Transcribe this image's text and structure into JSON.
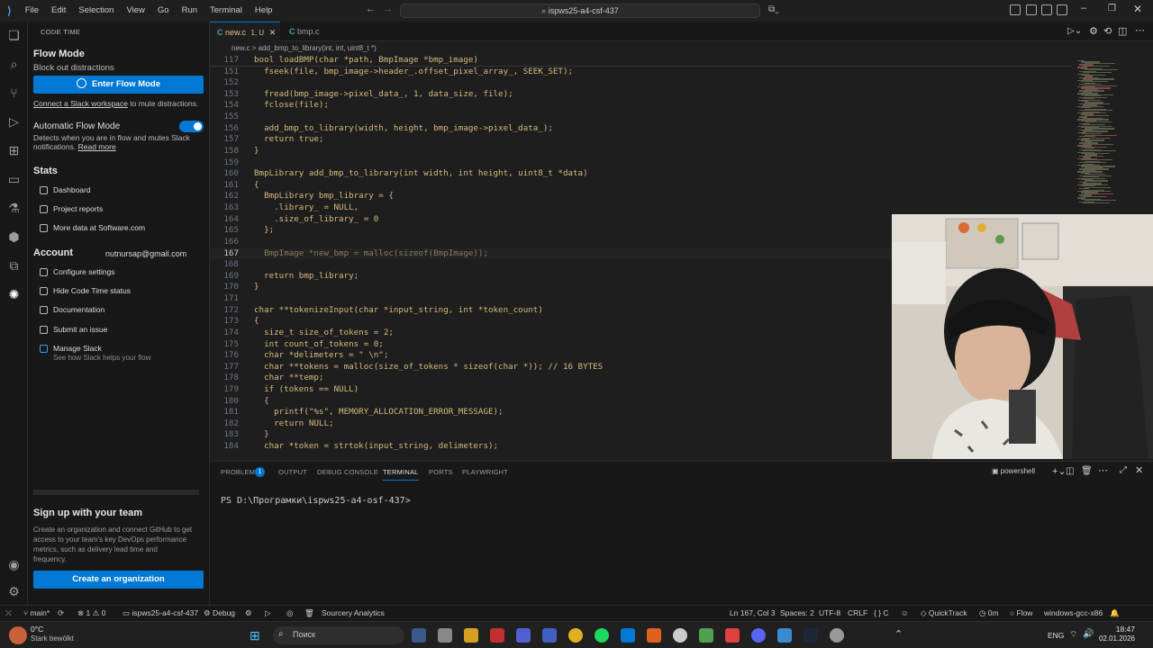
{
  "titlebar": {
    "menu": [
      "File",
      "Edit",
      "Selection",
      "View",
      "Go",
      "Run",
      "Terminal",
      "Help"
    ],
    "search": "ispws25-a4-csf-437"
  },
  "sidebar": {
    "header": "CODE TIME",
    "flow_title": "Flow Mode",
    "flow_sub": "Block out distractions",
    "enter_flow": "Enter Flow Mode",
    "slack_link": "Connect a Slack workspace",
    "slack_rest": " to mute distractions.",
    "auto_title": "Automatic Flow Mode",
    "auto_desc1": "Detects when you are in flow and mutes Slack",
    "auto_desc2": "notifications. ",
    "read_more": "Read more",
    "stats_title": "Stats",
    "stats": [
      "Dashboard",
      "Project reports",
      "More data at Software.com"
    ],
    "account_title": "Account",
    "email": "nutnursap@gmail.com",
    "account": [
      "Configure settings",
      "Hide Code Time status",
      "Documentation",
      "Submit an issue",
      "Manage Slack"
    ],
    "manage_slack_sub": "See how Slack helps your flow",
    "team_title": "Sign up with your team",
    "team_desc": [
      "Create an organization and connect GitHub to get",
      "access to your team's key DevOps performance",
      "metrics, such as delivery lead time and",
      "frequency."
    ],
    "create_org": "Create an organization"
  },
  "tabs": [
    {
      "label": "new.c",
      "badge": "1, U",
      "active": true
    },
    {
      "label": "bmp.c",
      "active": false
    }
  ],
  "breadcrumb": "new.c  >  add_bmp_to_library(int, int, uint8_t *)",
  "editor": {
    "lines": [
      {
        "n": "117",
        "t": "bool loadBMP(char *path, BmpImage *bmp_image)"
      },
      {
        "n": "151",
        "t": "  fseek(file, bmp_image->header_.offset_pixel_array_, SEEK_SET);"
      },
      {
        "n": "152",
        "t": ""
      },
      {
        "n": "153",
        "t": "  fread(bmp_image->pixel_data_, 1, data_size, file);"
      },
      {
        "n": "154",
        "t": "  fclose(file);"
      },
      {
        "n": "155",
        "t": ""
      },
      {
        "n": "156",
        "t": "  add_bmp_to_library(width, height, bmp_image->pixel_data_);"
      },
      {
        "n": "157",
        "t": "  return true;"
      },
      {
        "n": "158",
        "t": "}"
      },
      {
        "n": "159",
        "t": ""
      },
      {
        "n": "160",
        "t": "BmpLibrary add_bmp_to_library(int width, int height, uint8_t *data)"
      },
      {
        "n": "161",
        "t": "{"
      },
      {
        "n": "162",
        "t": "  BmpLibrary bmp_library = {"
      },
      {
        "n": "163",
        "t": "    .library_ = NULL,"
      },
      {
        "n": "164",
        "t": "    .size_of_library_ = 0"
      },
      {
        "n": "165",
        "t": "  };"
      },
      {
        "n": "166",
        "t": ""
      },
      {
        "n": "167",
        "t": "  BmpImage *new_bmp = malloc(sizeof(BmpImage));"
      },
      {
        "n": "168",
        "t": ""
      },
      {
        "n": "169",
        "t": "  return bmp_library;"
      },
      {
        "n": "170",
        "t": "}"
      },
      {
        "n": "171",
        "t": ""
      },
      {
        "n": "172",
        "t": "char **tokenizeInput(char *input_string, int *token_count)"
      },
      {
        "n": "173",
        "t": "{"
      },
      {
        "n": "174",
        "t": "  size_t size_of_tokens = 2;"
      },
      {
        "n": "175",
        "t": "  int count_of_tokens = 0;"
      },
      {
        "n": "176",
        "t": "  char *delimeters = \" \\n\";"
      },
      {
        "n": "177",
        "t": "  char **tokens = malloc(size_of_tokens * sizeof(char *)); // 16 BYTES"
      },
      {
        "n": "178",
        "t": "  char **temp;"
      },
      {
        "n": "179",
        "t": "  if (tokens == NULL)"
      },
      {
        "n": "180",
        "t": "  {"
      },
      {
        "n": "181",
        "t": "    printf(\"%s\", MEMORY_ALLOCATION_ERROR_MESSAGE);"
      },
      {
        "n": "182",
        "t": "    return NULL;"
      },
      {
        "n": "183",
        "t": "  }"
      },
      {
        "n": "184",
        "t": "  char *token = strtok(input_string, delimeters);"
      }
    ]
  },
  "panel": {
    "tabs": [
      "PROBLEMS",
      "OUTPUT",
      "DEBUG CONSOLE",
      "TERMINAL",
      "PORTS",
      "PLAYWRIGHT"
    ],
    "problems_count": "1",
    "shell": "powershell",
    "prompt": "PS D:\\Програмки\\ispws25-a4-osf-437>"
  },
  "statusbar": {
    "branch": "main*",
    "errors": "1",
    "warnings": "0",
    "workspace": "ispws25-a4-csf-437",
    "debug": "Debug",
    "sourcery": "Sourcery Analytics",
    "position": "Ln 167, Col 3",
    "spaces": "Spaces: 2",
    "encoding": "UTF-8",
    "eol": "CRLF",
    "language": "C",
    "quicktrack": "QuickTrack",
    "time": "0m",
    "flow": "Flow",
    "config": "windows-gcc-x86"
  },
  "taskbar": {
    "temp": "0°C",
    "weather": "Stark bewölkt",
    "search": "Поиск",
    "lang": "ENG",
    "clock": "18:47",
    "date": "02.01.2026"
  }
}
